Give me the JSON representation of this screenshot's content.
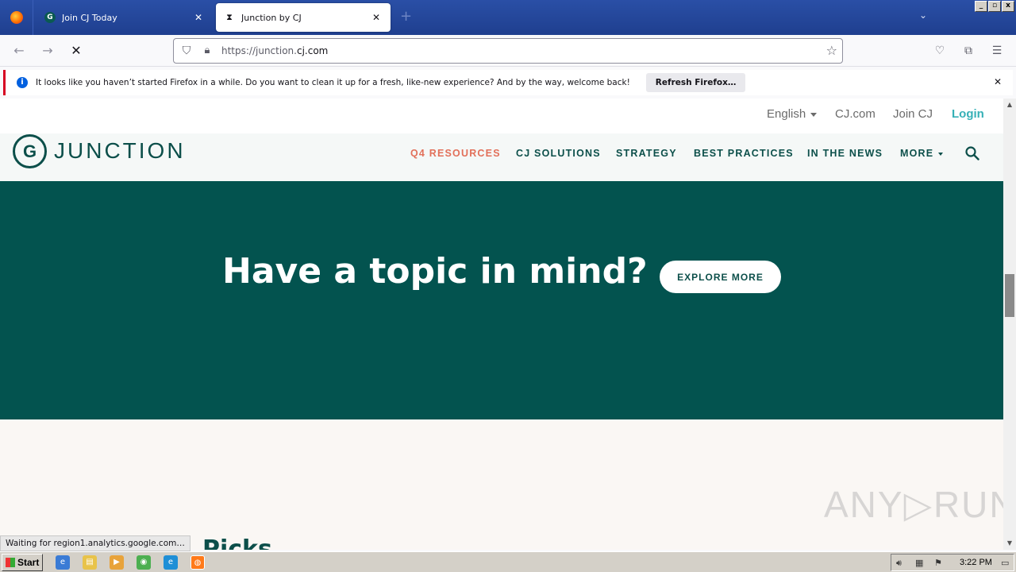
{
  "browser": {
    "tabs": [
      {
        "label": "Join CJ Today",
        "favicon": "cj-logo-icon",
        "active": false
      },
      {
        "label": "Junction by CJ",
        "favicon": "hourglass-icon",
        "active": true
      }
    ],
    "new_tab_label": "+",
    "url": {
      "prefix": "https://junction.",
      "domain": "cj.com"
    },
    "window_controls": [
      "_",
      "▫",
      "x"
    ]
  },
  "notification": {
    "text": "It looks like you haven’t started Firefox in a while. Do you want to clean it up for a fresh, like-new experience? And by the way, welcome back!",
    "button": "Refresh Firefox…"
  },
  "site": {
    "top_links": {
      "language": "English",
      "cj": "CJ.com",
      "join": "Join CJ",
      "login": "Login"
    },
    "logo": {
      "mark": "G",
      "text": "JUNCTION"
    },
    "nav": [
      "Q4 RESOURCES",
      "CJ SOLUTIONS",
      "STRATEGY",
      "BEST PRACTICES",
      "IN THE NEWS",
      "MORE"
    ],
    "hero": {
      "title": "Have a topic in mind?",
      "button": "EXPLORE MORE"
    },
    "section_heading": "Picks",
    "colors": {
      "primary": "#03534f",
      "accent": "#e2705a",
      "login": "#36b0b6"
    }
  },
  "status_text": "Waiting for region1.analytics.google.com…",
  "watermark": "ANY▷RUN",
  "taskbar": {
    "start": "Start",
    "clock": "3:22 PM"
  }
}
